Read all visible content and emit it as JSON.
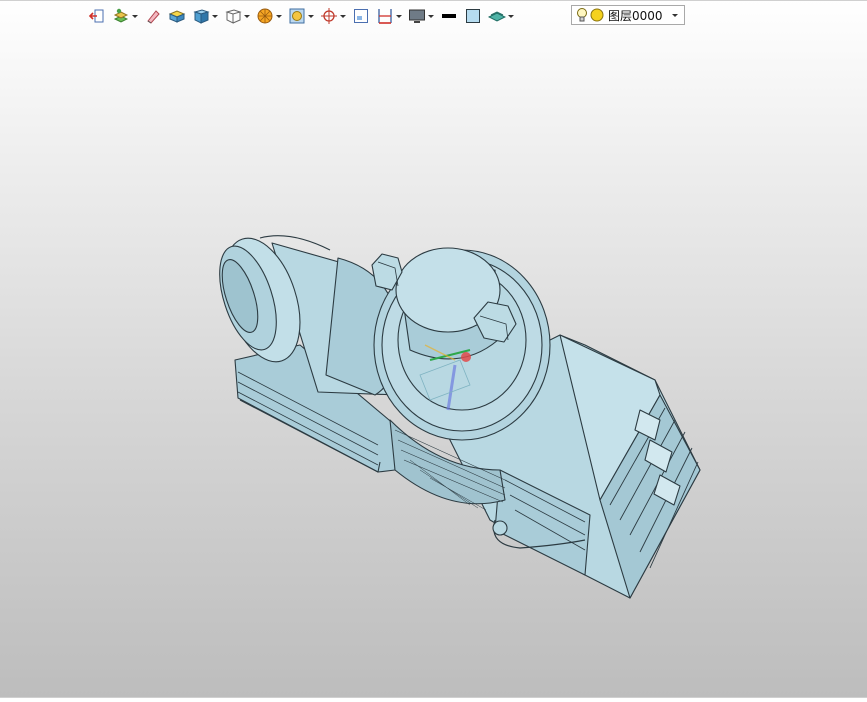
{
  "toolbar": {
    "layer_selector": {
      "value": "图层0000",
      "icons": [
        "lightbulb-icon",
        "yellow-circle-icon"
      ]
    },
    "icons": [
      "exit-sketch-icon",
      "layers-stack-icon",
      "eraser-icon",
      "yellow-box-icon",
      "blue-cube-icon",
      "wireframe-cube-icon",
      "orange-sphere-icon",
      "render-mode-icon",
      "target-snap-icon",
      "small-view-icon",
      "dimension-icon",
      "monitor-icon",
      "black-line-icon",
      "light-blue-square-icon",
      "teal-plane-icon"
    ]
  },
  "colors": {
    "model_fill": "#b6d6e0",
    "model_edge": "#2c3b42",
    "viewport_top": "#ffffff",
    "viewport_bottom": "#bdbdbd"
  }
}
